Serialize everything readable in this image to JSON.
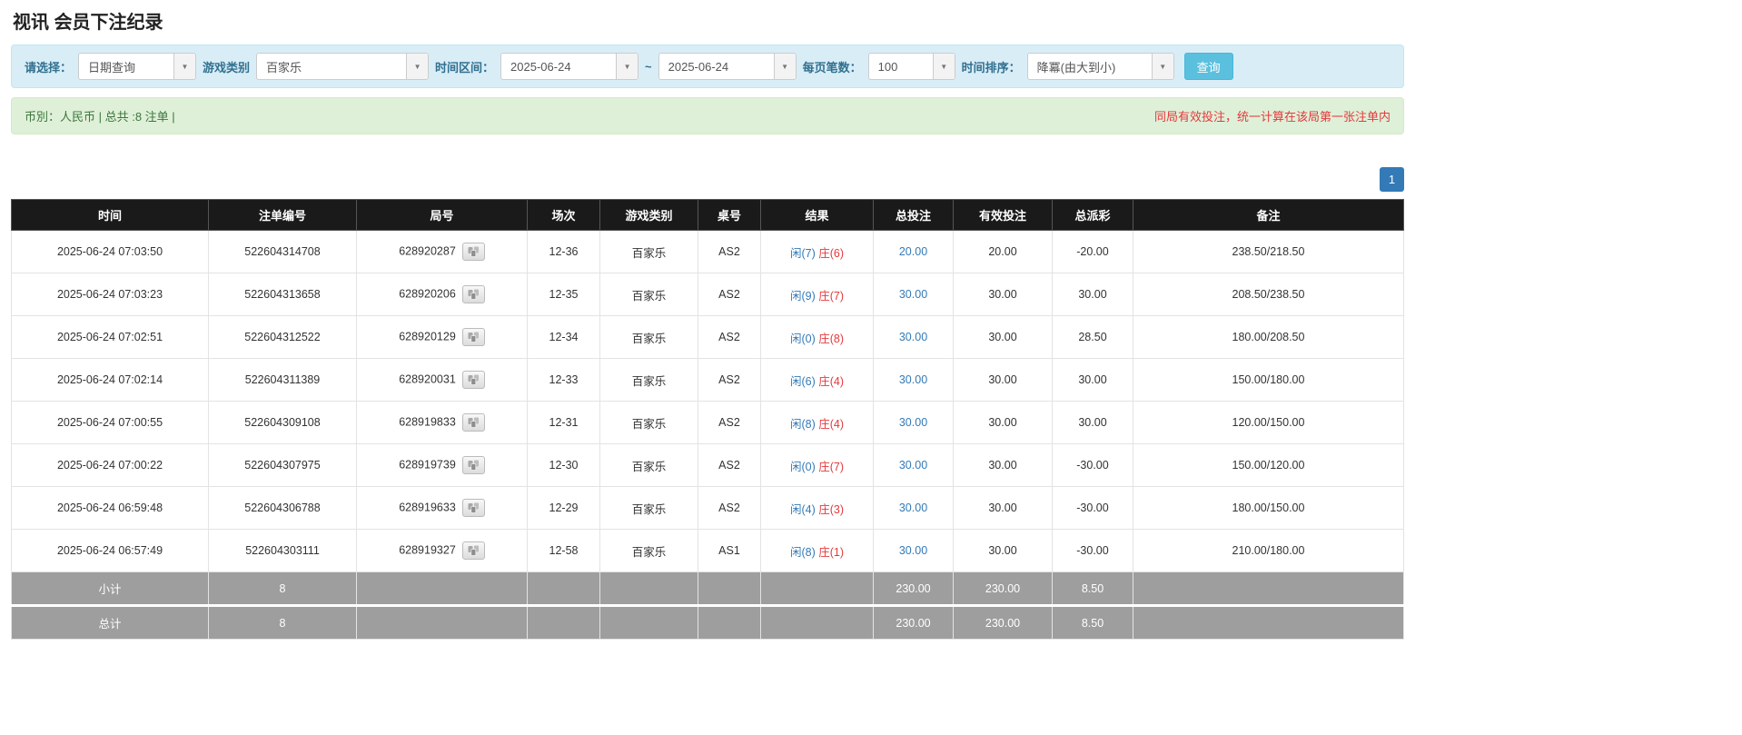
{
  "colors": {
    "accent_blue": "#337ab7",
    "search_button_blue": "#5bc0de",
    "filter_bar_bg": "#d9edf7",
    "info_bar_bg": "#dff0d8",
    "info_text_green": "#3c763d",
    "alert_red": "#e4393c",
    "table_header_bg": "#1a1a1a",
    "summary_row_bg": "#9e9e9e"
  },
  "page": {
    "title": "视讯 会员下注纪录"
  },
  "filters": {
    "select_label": "请选择：",
    "select_value": "日期查询",
    "game_type_label": "游戏类别",
    "game_type_value": "百家乐",
    "time_range_label": "时间区间：",
    "date_from": "2025-06-24",
    "range_separator": "~",
    "date_to": "2025-06-24",
    "per_page_label": "每页笔数：",
    "per_page_value": "100",
    "sort_label": "时间排序：",
    "sort_value": "降冪(由大到小)",
    "search_button_label": "查询",
    "dropdown_caret": "▼"
  },
  "summary_bar": {
    "left_text": "币別：人民币 | 总共 :8 注单 |",
    "right_text": "同局有效投注，统一计算在该局第一张注单内"
  },
  "pagination": {
    "page": "1"
  },
  "table": {
    "headers": [
      "时间",
      "注单编号",
      "局号",
      "场次",
      "游戏类别",
      "桌号",
      "结果",
      "总投注",
      "有效投注",
      "总派彩",
      "备注"
    ],
    "rows": [
      {
        "time": "2025-06-24 07:03:50",
        "bet_id": "522604314708",
        "round_id": "628920287",
        "session": "12-36",
        "game": "百家乐",
        "table_no": "AS2",
        "player": "闲(7)",
        "banker": "庄(6)",
        "total_bet": "20.00",
        "valid_bet": "20.00",
        "payout": "-20.00",
        "remark": "238.50/218.50"
      },
      {
        "time": "2025-06-24 07:03:23",
        "bet_id": "522604313658",
        "round_id": "628920206",
        "session": "12-35",
        "game": "百家乐",
        "table_no": "AS2",
        "player": "闲(9)",
        "banker": "庄(7)",
        "total_bet": "30.00",
        "valid_bet": "30.00",
        "payout": "30.00",
        "remark": "208.50/238.50"
      },
      {
        "time": "2025-06-24 07:02:51",
        "bet_id": "522604312522",
        "round_id": "628920129",
        "session": "12-34",
        "game": "百家乐",
        "table_no": "AS2",
        "player": "闲(0)",
        "banker": "庄(8)",
        "total_bet": "30.00",
        "valid_bet": "30.00",
        "payout": "28.50",
        "remark": "180.00/208.50"
      },
      {
        "time": "2025-06-24 07:02:14",
        "bet_id": "522604311389",
        "round_id": "628920031",
        "session": "12-33",
        "game": "百家乐",
        "table_no": "AS2",
        "player": "闲(6)",
        "banker": "庄(4)",
        "total_bet": "30.00",
        "valid_bet": "30.00",
        "payout": "30.00",
        "remark": "150.00/180.00"
      },
      {
        "time": "2025-06-24 07:00:55",
        "bet_id": "522604309108",
        "round_id": "628919833",
        "session": "12-31",
        "game": "百家乐",
        "table_no": "AS2",
        "player": "闲(8)",
        "banker": "庄(4)",
        "total_bet": "30.00",
        "valid_bet": "30.00",
        "payout": "30.00",
        "remark": "120.00/150.00"
      },
      {
        "time": "2025-06-24 07:00:22",
        "bet_id": "522604307975",
        "round_id": "628919739",
        "session": "12-30",
        "game": "百家乐",
        "table_no": "AS2",
        "player": "闲(0)",
        "banker": "庄(7)",
        "total_bet": "30.00",
        "valid_bet": "30.00",
        "payout": "-30.00",
        "remark": "150.00/120.00"
      },
      {
        "time": "2025-06-24 06:59:48",
        "bet_id": "522604306788",
        "round_id": "628919633",
        "session": "12-29",
        "game": "百家乐",
        "table_no": "AS2",
        "player": "闲(4)",
        "banker": "庄(3)",
        "total_bet": "30.00",
        "valid_bet": "30.00",
        "payout": "-30.00",
        "remark": "180.00/150.00"
      },
      {
        "time": "2025-06-24 06:57:49",
        "bet_id": "522604303111",
        "round_id": "628919327",
        "session": "12-58",
        "game": "百家乐",
        "table_no": "AS1",
        "player": "闲(8)",
        "banker": "庄(1)",
        "total_bet": "30.00",
        "valid_bet": "30.00",
        "payout": "-30.00",
        "remark": "210.00/180.00"
      }
    ],
    "subtotal": {
      "label": "小计",
      "count": "8",
      "total_bet": "230.00",
      "valid_bet": "230.00",
      "payout": "8.50"
    },
    "total": {
      "label": "总计",
      "count": "8",
      "total_bet": "230.00",
      "valid_bet": "230.00",
      "payout": "8.50"
    }
  }
}
